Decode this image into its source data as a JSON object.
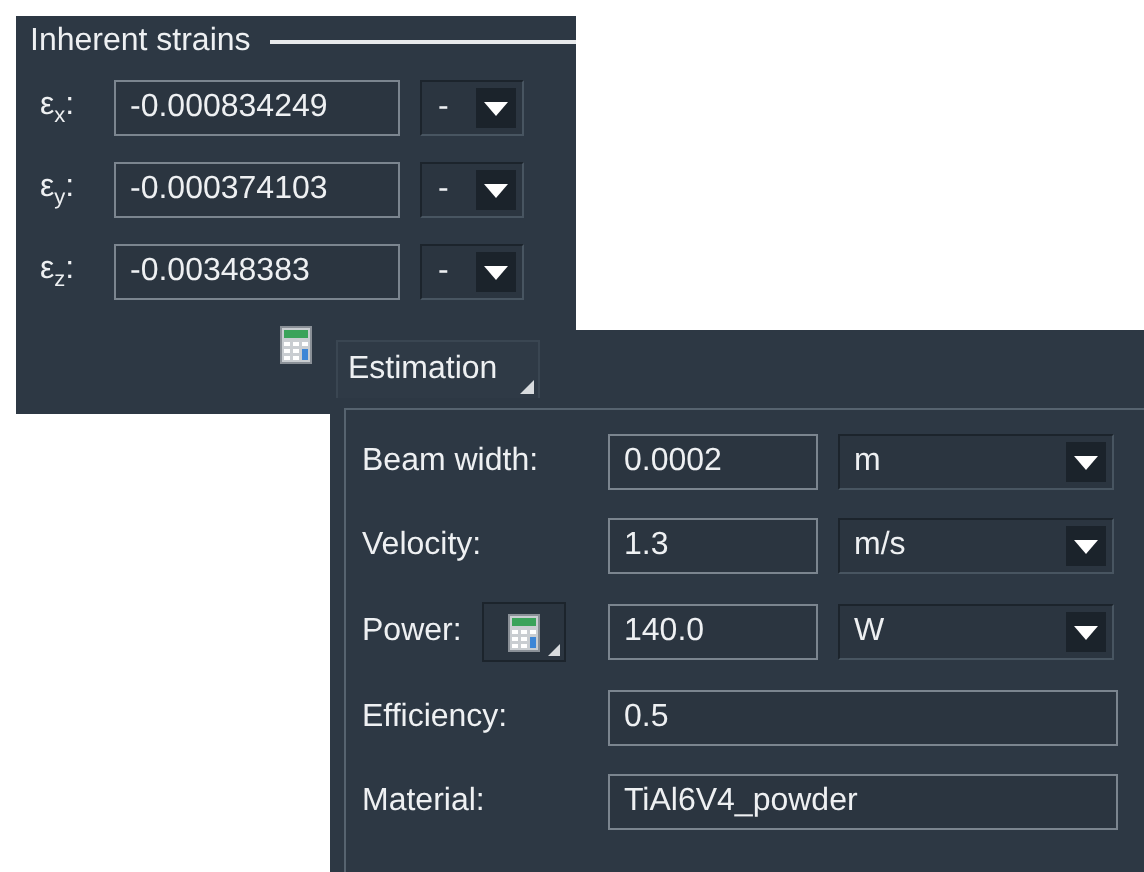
{
  "inherent_strains": {
    "title": "Inherent strains",
    "rows": [
      {
        "label": "ε$_{x}$:",
        "value": "-0.000834249",
        "unit": "-"
      },
      {
        "label": "ε$_{y}$:",
        "value": "-0.000374103",
        "unit": "-"
      },
      {
        "label": "ε$_{z}$:",
        "value": "-0.00348383",
        "unit": "-"
      }
    ]
  },
  "estimation": {
    "button": "Estimation",
    "rows": [
      {
        "kind": "select",
        "label": "Beam width:",
        "value": "0.0002",
        "unit": "m"
      },
      {
        "kind": "select",
        "label": "Velocity:",
        "value": "1.3",
        "unit": "m/s"
      },
      {
        "kind": "calc",
        "label": "Power:",
        "value": "140.0",
        "unit": "W"
      },
      {
        "kind": "text",
        "label": "Efficiency:",
        "value": "0.5"
      },
      {
        "kind": "text",
        "label": "Material:",
        "value": "TiAl6V4_powder"
      }
    ]
  }
}
